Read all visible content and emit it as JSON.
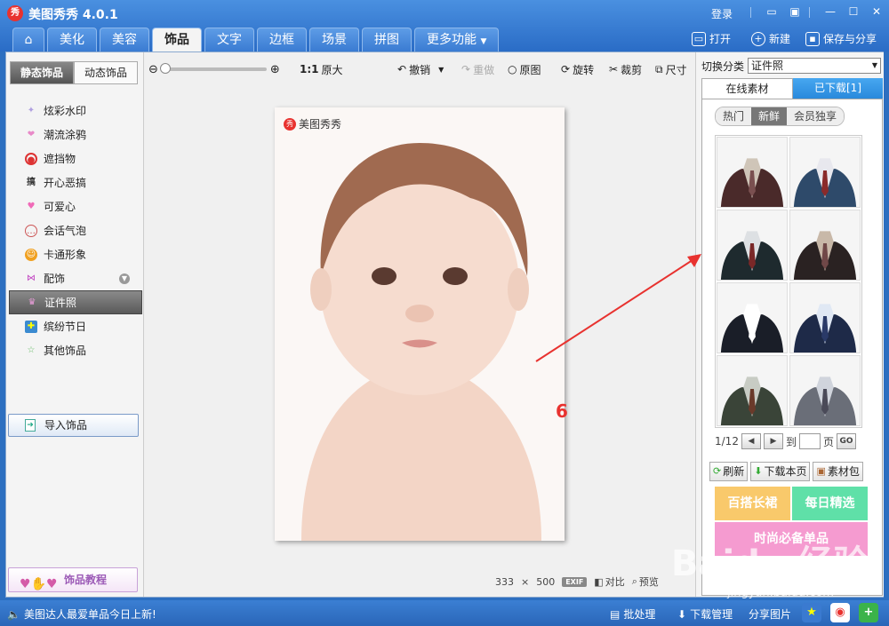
{
  "window": {
    "logo_char": "秀",
    "title": "美图秀秀 4.0.1",
    "login": "登录"
  },
  "tabs": [
    {
      "label": "美化"
    },
    {
      "label": "美容"
    },
    {
      "label": "饰品"
    },
    {
      "label": "文字"
    },
    {
      "label": "边框"
    },
    {
      "label": "场景"
    },
    {
      "label": "拼图"
    },
    {
      "label": "更多功能"
    }
  ],
  "top_actions": {
    "open": "打开",
    "new": "新建",
    "save_share": "保存与分享"
  },
  "left": {
    "tab_static": "静态饰品",
    "tab_dynamic": "动态饰品",
    "categories": [
      {
        "label": "炫彩水印",
        "icon": "sparkle-icon",
        "color": "#b0a0e0"
      },
      {
        "label": "潮流涂鸦",
        "icon": "lips-icon",
        "color": "#e889c8"
      },
      {
        "label": "遮挡物",
        "icon": "mask-icon",
        "color": "#d33"
      },
      {
        "label": "开心恶搞",
        "icon": "prank-icon",
        "color": "#333"
      },
      {
        "label": "可爱心",
        "icon": "heart-icon",
        "color": "#f06ab8"
      },
      {
        "label": "会话气泡",
        "icon": "speech-bubble-icon",
        "color": "#c55"
      },
      {
        "label": "卡通形象",
        "icon": "cartoon-icon",
        "color": "#f0a020"
      },
      {
        "label": "配饰",
        "icon": "bow-icon",
        "color": "#c040c0"
      },
      {
        "label": "证件照",
        "icon": "shirt-icon",
        "color": "#e89cd8"
      },
      {
        "label": "缤纷节日",
        "icon": "gift-icon",
        "color": "#3a8ad0"
      },
      {
        "label": "其他饰品",
        "icon": "star-icon",
        "color": "#6b6"
      }
    ],
    "import_label": "导入饰品",
    "tutorial_label": "饰品教程"
  },
  "toolbar": {
    "ratio": "1:1",
    "original_size": "原大",
    "undo": "撤销",
    "redo": "重做",
    "original": "原图",
    "rotate": "旋转",
    "crop": "裁剪",
    "size": "尺寸"
  },
  "photo": {
    "watermark": "美图秀秀"
  },
  "canvas_info": {
    "width": "333",
    "times": "×",
    "height": "500",
    "exif": "EXIF",
    "compare": "对比",
    "preview": "预览"
  },
  "annotation": {
    "number": "6"
  },
  "right": {
    "switch_label": "切换分类",
    "category_value": "证件照",
    "tab_online": "在线素材",
    "tab_downloaded": "已下载[1]",
    "filters": [
      "热门",
      "新鲜",
      "会员独享"
    ],
    "suit_colors": [
      "#4a2a2a",
      "#2e4a6a",
      "#1e2a2e",
      "#2a2222",
      "#1a1e28",
      "#1e2a48",
      "#3a4438",
      "#6a6e78"
    ],
    "shirt_colors": [
      "#cfc5b8",
      "#e8e8ee",
      "#dde0e3",
      "#c8b8a8",
      "#ffffff",
      "#e0e8f4",
      "#c8ccc4",
      "#d0d4dc"
    ],
    "tie_colors": [
      "#7a5050",
      "#8a2a2a",
      "#7a2828",
      "#704848",
      "#ffffff",
      "#2a3a68",
      "#6a3a2a",
      "#4a4a58"
    ],
    "page_current": "1/12",
    "page_to": "到",
    "page_unit": "页",
    "go": "GO",
    "refresh": "刷新",
    "download_page": "下载本页",
    "material_pack": "素材包",
    "promos": [
      {
        "label": "百搭长裙",
        "color": "#f9c96b"
      },
      {
        "label": "每日精选",
        "color": "#5fe0a8"
      },
      {
        "label": "时尚必备单品",
        "color": "#f59bd0"
      }
    ]
  },
  "watermark": {
    "brand": "Baidu 经验",
    "url": "jingyan.baidu.com"
  },
  "statusbar": {
    "notice": "美图达人最爱单品今日上新!",
    "batch": "批处理",
    "download_manager": "下载管理",
    "share_photo": "分享图片"
  }
}
